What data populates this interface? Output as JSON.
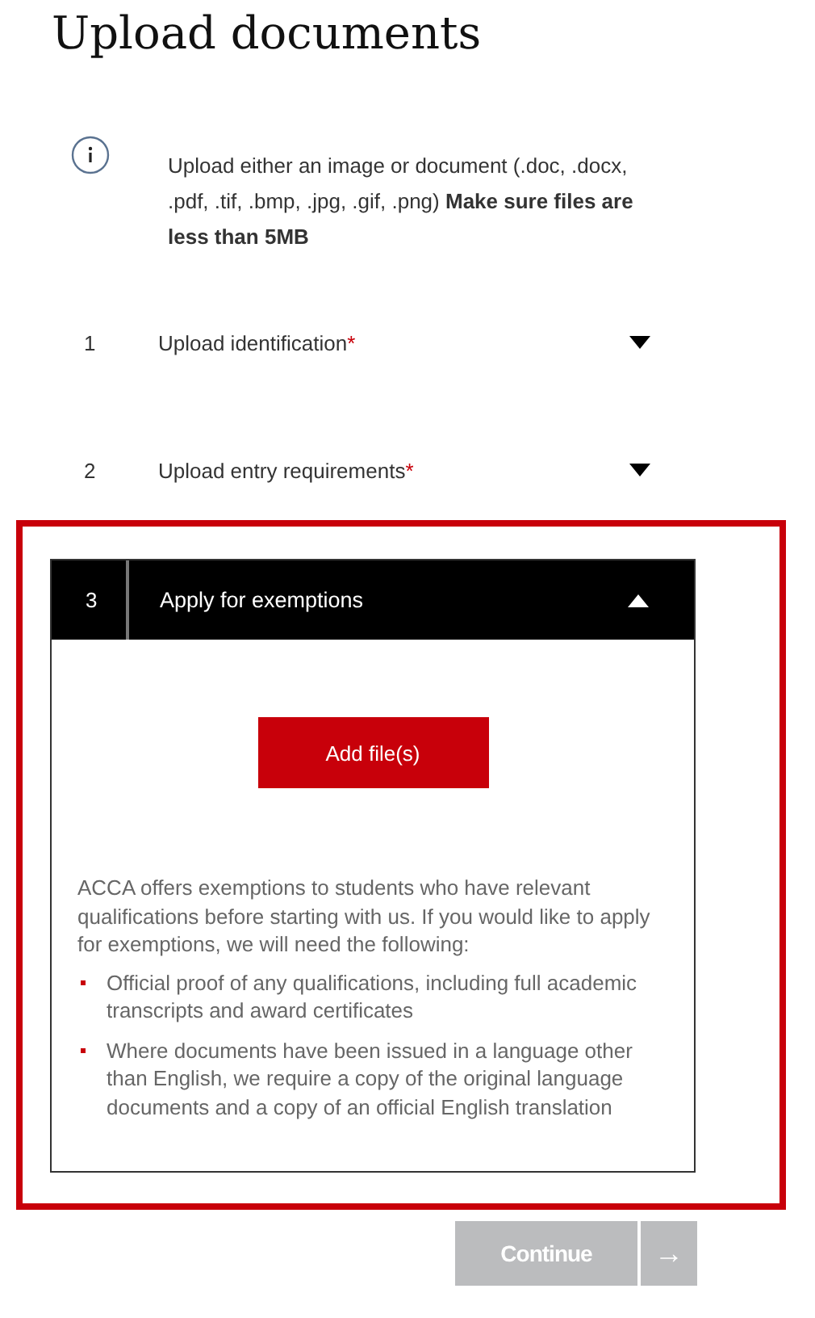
{
  "title": "Upload documents",
  "info": {
    "text": "Upload either an image or document (.doc, .docx, .pdf, .tif, .bmp, .jpg, .gif, .png) **Make sure files are less than 5MB**"
  },
  "sections": [
    {
      "number": "1",
      "label": "Upload identification",
      "required_mark": "*",
      "expanded": false,
      "highlighted": false
    },
    {
      "number": "2",
      "label": "Upload entry requirements",
      "required_mark": "*",
      "expanded": false,
      "highlighted": false
    },
    {
      "number": "3",
      "label": "Apply for exemptions",
      "expanded": true,
      "highlighted": true,
      "add_button": "Add file(s)",
      "description": "ACCA offers exemptions to students who have relevant qualifications before starting with us. If you would like to apply for exemptions, we will need the following:",
      "bullets": [
        "Official proof of any qualifications, including full academic transcripts and award certificates",
        "Where documents have been issued in a language other than English, we require a copy of the original language documents and a copy of an official English translation"
      ]
    }
  ],
  "continue_button": {
    "label": "Continue",
    "arrow": "→",
    "disabled": true
  }
}
